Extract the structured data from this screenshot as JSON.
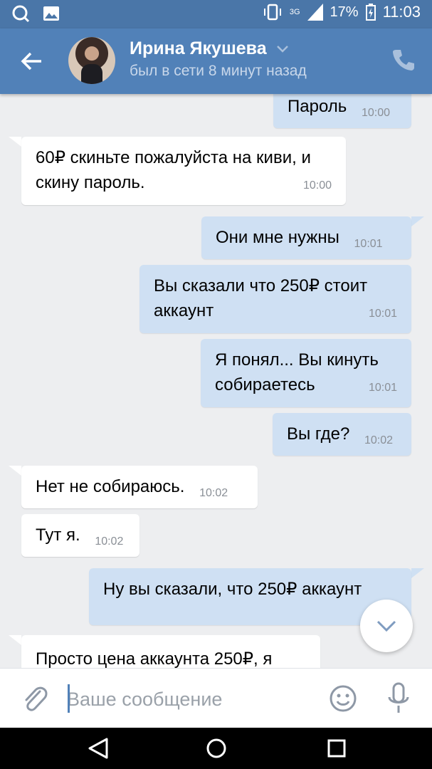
{
  "status_bar": {
    "network": "3G",
    "battery": "17%",
    "time": "11:03"
  },
  "header": {
    "name": "Ирина Якушева",
    "status": "был в сети 8 минут назад"
  },
  "messages": [
    {
      "dir": "out",
      "text": "Пароль",
      "time": "10:00"
    },
    {
      "dir": "in",
      "text": "60₽ скиньте пожалуйста на киви, и скину пароль.",
      "time": "10:00"
    },
    {
      "dir": "out",
      "text": "Они мне нужны",
      "time": "10:01"
    },
    {
      "dir": "out",
      "text": "Вы сказали что 250₽ стоит аккаунт",
      "time": "10:01"
    },
    {
      "dir": "out",
      "text": "Я понял... Вы кинуть собираетесь",
      "time": "10:01"
    },
    {
      "dir": "out",
      "text": "Вы где?",
      "time": "10:02"
    },
    {
      "dir": "in",
      "text": "Нет не собираюсь.",
      "time": "10:02"
    },
    {
      "dir": "in",
      "text": "Тут я.",
      "time": "10:02"
    },
    {
      "dir": "out",
      "text": "Ну вы сказали, что 250₽ аккаунт",
      "time": ""
    },
    {
      "dir": "in",
      "text": "Просто цена аккаунта 250₽, я",
      "time": ""
    }
  ],
  "composer": {
    "placeholder": "Ваше сообщение"
  },
  "icons": {
    "back": "arrow-left-icon",
    "call": "phone-icon",
    "attach": "paperclip-icon",
    "emoji": "smiley-icon",
    "mic": "microphone-icon",
    "scroll": "chevron-down-icon"
  },
  "colors": {
    "header": "#5181b8",
    "status_bar": "#4a76a8",
    "outgoing": "#cfe0f3",
    "incoming": "#ffffff",
    "background": "#edeef0"
  }
}
